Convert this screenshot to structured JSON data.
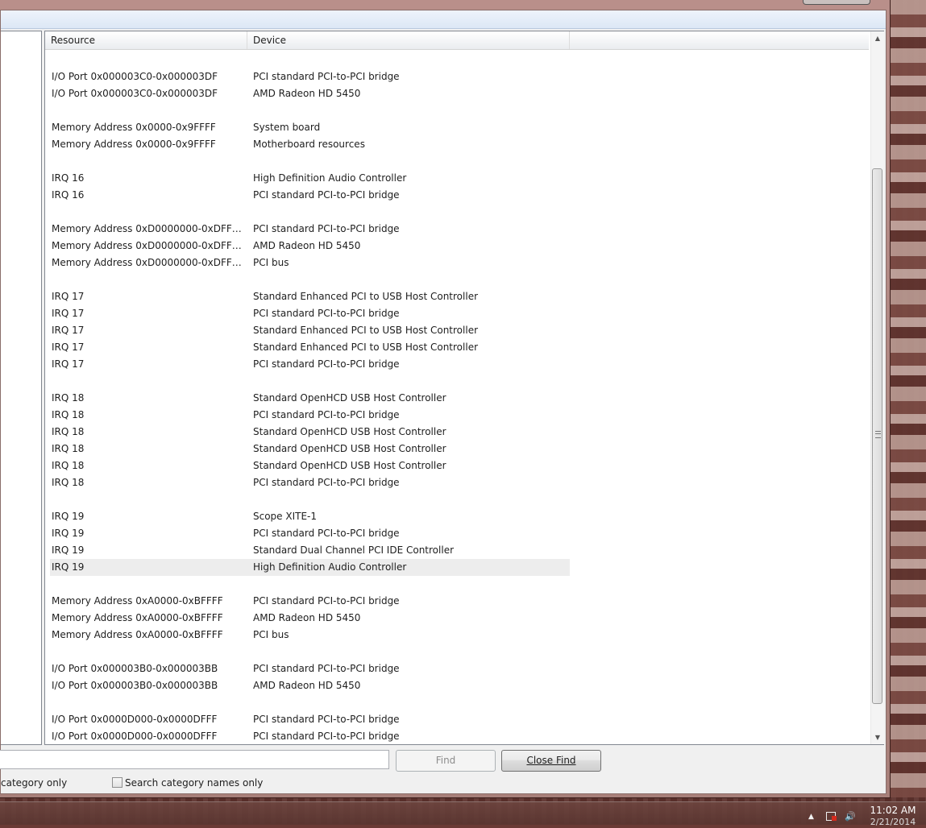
{
  "list": {
    "columns": {
      "resource": "Resource",
      "device": "Device"
    },
    "rows": [
      {
        "resource": "I/O Port 0x000003C0-0x000003DF",
        "device": "PCI standard PCI-to-PCI bridge"
      },
      {
        "resource": "I/O Port 0x000003C0-0x000003DF",
        "device": "AMD Radeon HD 5450"
      },
      {
        "resource": "Memory Address 0x0000-0x9FFFF",
        "device": "System board"
      },
      {
        "resource": "Memory Address 0x0000-0x9FFFF",
        "device": "Motherboard resources"
      },
      {
        "resource": "IRQ 16",
        "device": "High Definition Audio Controller"
      },
      {
        "resource": "IRQ 16",
        "device": "PCI standard PCI-to-PCI bridge"
      },
      {
        "resource": "Memory Address 0xD0000000-0xDFFFFF...",
        "device": "PCI standard PCI-to-PCI bridge"
      },
      {
        "resource": "Memory Address 0xD0000000-0xDFFFFF...",
        "device": "AMD Radeon HD 5450"
      },
      {
        "resource": "Memory Address 0xD0000000-0xDFFFFF...",
        "device": "PCI bus"
      },
      {
        "resource": "IRQ 17",
        "device": "Standard Enhanced PCI to USB Host Controller"
      },
      {
        "resource": "IRQ 17",
        "device": "PCI standard PCI-to-PCI bridge"
      },
      {
        "resource": "IRQ 17",
        "device": "Standard Enhanced PCI to USB Host Controller"
      },
      {
        "resource": "IRQ 17",
        "device": "Standard Enhanced PCI to USB Host Controller"
      },
      {
        "resource": "IRQ 17",
        "device": "PCI standard PCI-to-PCI bridge"
      },
      {
        "resource": "IRQ 18",
        "device": "Standard OpenHCD USB Host Controller"
      },
      {
        "resource": "IRQ 18",
        "device": "PCI standard PCI-to-PCI bridge"
      },
      {
        "resource": "IRQ 18",
        "device": "Standard OpenHCD USB Host Controller"
      },
      {
        "resource": "IRQ 18",
        "device": "Standard OpenHCD USB Host Controller"
      },
      {
        "resource": "IRQ 18",
        "device": "Standard OpenHCD USB Host Controller"
      },
      {
        "resource": "IRQ 18",
        "device": "PCI standard PCI-to-PCI bridge"
      },
      {
        "resource": "IRQ 19",
        "device": "Scope XITE-1"
      },
      {
        "resource": "IRQ 19",
        "device": "PCI standard PCI-to-PCI bridge"
      },
      {
        "resource": "IRQ 19",
        "device": "Standard Dual Channel PCI IDE Controller"
      },
      {
        "resource": "IRQ 19",
        "device": "High Definition Audio Controller",
        "selected": true
      },
      {
        "resource": "Memory Address 0xA0000-0xBFFFF",
        "device": "PCI standard PCI-to-PCI bridge"
      },
      {
        "resource": "Memory Address 0xA0000-0xBFFFF",
        "device": "AMD Radeon HD 5450"
      },
      {
        "resource": "Memory Address 0xA0000-0xBFFFF",
        "device": "PCI bus"
      },
      {
        "resource": "I/O Port 0x000003B0-0x000003BB",
        "device": "PCI standard PCI-to-PCI bridge"
      },
      {
        "resource": "I/O Port 0x000003B0-0x000003BB",
        "device": "AMD Radeon HD 5450"
      },
      {
        "resource": "I/O Port 0x0000D000-0x0000DFFF",
        "device": "PCI standard PCI-to-PCI bridge"
      },
      {
        "resource": "I/O Port 0x0000D000-0x0000DFFF",
        "device": "PCI standard PCI-to-PCI bridge"
      }
    ]
  },
  "find_bar": {
    "find_label": "Find",
    "close_find_label": "Close Find",
    "search_selected_label": "category only",
    "search_names_label": "Search category names only",
    "search_names_checked": false
  },
  "taskbar": {
    "time": "11:02 AM",
    "date": "2/21/2014"
  },
  "colors": {
    "selected_row": "#ededed",
    "window_frame": "#a8807a"
  }
}
